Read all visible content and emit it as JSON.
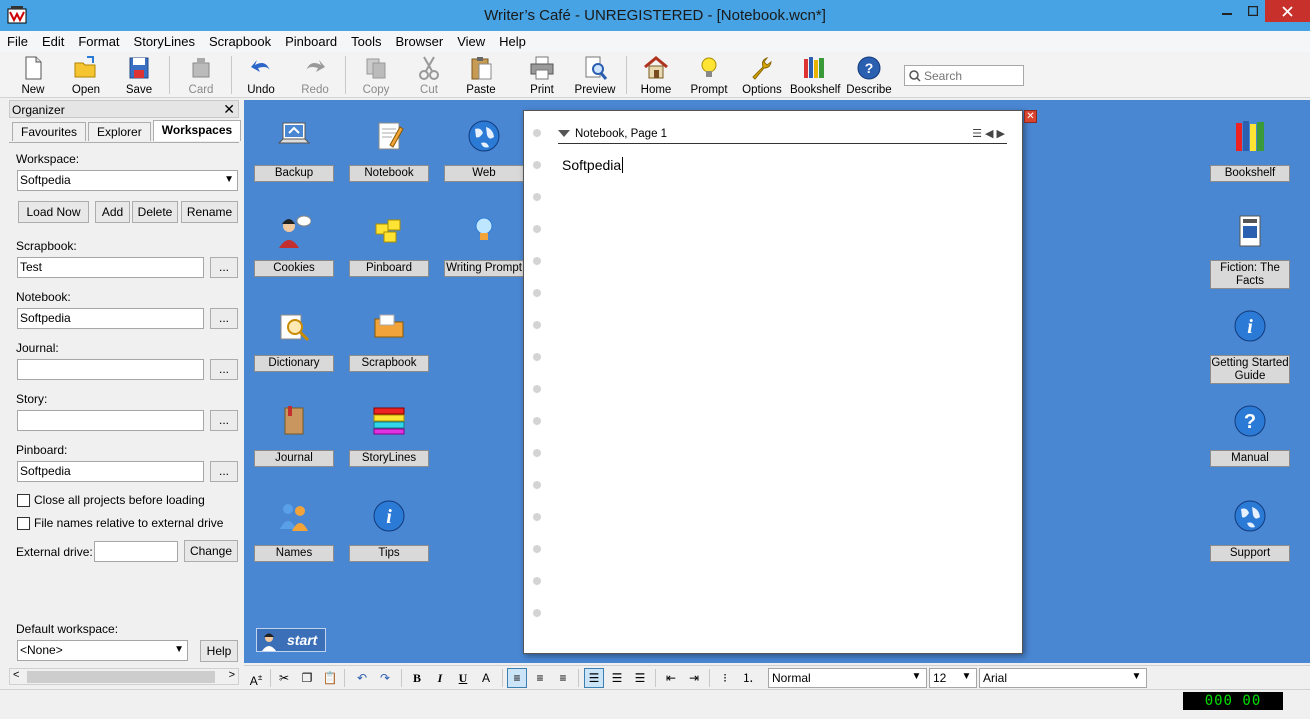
{
  "window": {
    "title": "Writer's Café - UNREGISTERED - [Notebook.wcn*]",
    "title_display": "Writer’s Café - UNREGISTERED - [Notebook.wcn*]"
  },
  "menu": [
    "File",
    "Edit",
    "Format",
    "StoryLines",
    "Scrapbook",
    "Pinboard",
    "Tools",
    "Browser",
    "View",
    "Help"
  ],
  "toolbar": {
    "new": "New",
    "open": "Open",
    "save": "Save",
    "card": "Card",
    "undo": "Undo",
    "redo": "Redo",
    "copy": "Copy",
    "cut": "Cut",
    "paste": "Paste",
    "print": "Print",
    "preview": "Preview",
    "home": "Home",
    "prompt": "Prompt",
    "options": "Options",
    "bookshelf": "Bookshelf",
    "describe": "Describe",
    "search_placeholder": "Search"
  },
  "organizer": {
    "title": "Organizer",
    "tabs": [
      "Favourites",
      "Explorer",
      "Workspaces"
    ],
    "active_tab": "Workspaces",
    "workspace_label": "Workspace:",
    "workspace_value": "Softpedia",
    "buttons": {
      "load_now": "Load Now",
      "add": "Add",
      "delete": "Delete",
      "rename": "Rename",
      "change": "Change",
      "help": "Help",
      "browse": "..."
    },
    "scrapbook_label": "Scrapbook:",
    "scrapbook_value": "Test",
    "notebook_label": "Notebook:",
    "notebook_value": "Softpedia",
    "journal_label": "Journal:",
    "journal_value": "",
    "story_label": "Story:",
    "story_value": "",
    "pinboard_label": "Pinboard:",
    "pinboard_value": "Softpedia",
    "close_all_label": "Close all projects before loading",
    "relative_label": "File names relative to external drive",
    "external_drive_label": "External drive:",
    "external_drive_value": "",
    "default_workspace_label": "Default workspace:",
    "default_workspace_value": "<None>"
  },
  "desktop": {
    "backup": "Backup",
    "notebook": "Notebook",
    "web": "Web",
    "cookies": "Cookies",
    "pinboard": "Pinboard",
    "writing_prompt": "Writing Prompt",
    "dictionary": "Dictionary",
    "scrapbook": "Scrapbook",
    "journal": "Journal",
    "storylines": "StoryLines",
    "names": "Names",
    "tips": "Tips",
    "bookshelf": "Bookshelf",
    "fiction_facts": "Fiction: The Facts",
    "getting_started": "Getting Started Guide",
    "manual": "Manual",
    "support": "Support",
    "start": "start"
  },
  "notebook": {
    "page_title": "Notebook, Page 1",
    "text": "Softpedia"
  },
  "format": {
    "style": "Normal",
    "size": "12",
    "font": "Arial"
  },
  "status": {
    "clock": "000 00"
  }
}
